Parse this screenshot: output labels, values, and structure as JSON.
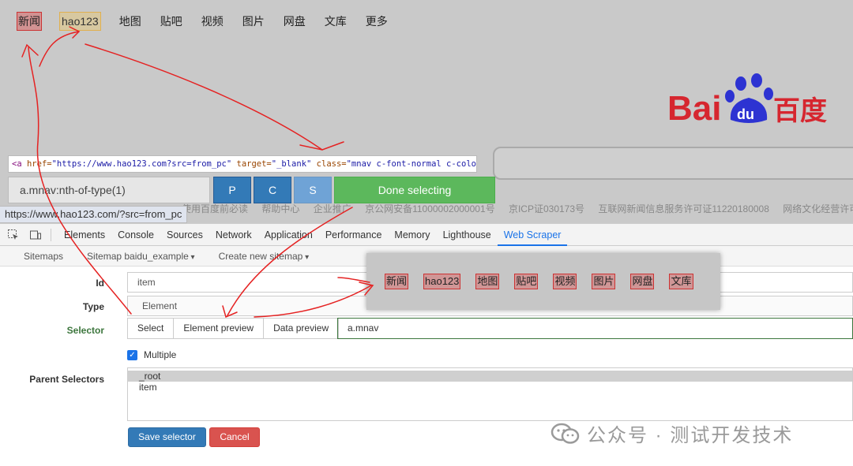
{
  "baidu": {
    "nav": [
      "新闻",
      "hao123",
      "地图",
      "贴吧",
      "视频",
      "图片",
      "网盘",
      "文库",
      "更多"
    ],
    "logo_text_left": "Bai",
    "logo_text_du": "du",
    "logo_text_cn": "百度",
    "footer": [
      "使用百度前必读",
      "帮助中心",
      "企业推广",
      "京公网安备11000002000001号",
      "京ICP证030173号",
      "互联网新闻信息服务许可证11220180008",
      "网络文化经营许可证："
    ]
  },
  "html_tip": {
    "open": "<a",
    "href_attr": "href=",
    "href_val": "\"https://www.hao123.com?src=from_pc\"",
    "target_attr": "target=",
    "target_val": "\"_blank\"",
    "class_attr": "class=",
    "class_val": "\"mnav c-font-normal c-color-t\"",
    "close": ">"
  },
  "selector_bar": {
    "value": "a.mnav:nth-of-type(1)",
    "p_label": "P",
    "c_label": "C",
    "s_label": "S",
    "done_label": "Done selecting"
  },
  "status_url": "https://www.hao123.com/?src=from_pc",
  "devtools": {
    "tabs": [
      "Elements",
      "Console",
      "Sources",
      "Network",
      "Application",
      "Performance",
      "Memory",
      "Lighthouse",
      "Web Scraper"
    ],
    "active_tab": "Web Scraper"
  },
  "ws_nav": {
    "sitemaps": "Sitemaps",
    "sitemap": "Sitemap baidu_example",
    "create": "Create new sitemap"
  },
  "form": {
    "id_label": "Id",
    "id_value": "item",
    "type_label": "Type",
    "type_value": "Element",
    "selector_label": "Selector",
    "select_btn": "Select",
    "element_preview_btn": "Element preview",
    "data_preview_btn": "Data preview",
    "selector_value": "a.mnav",
    "multiple_label": "Multiple",
    "multiple_checked": true,
    "parent_label": "Parent Selectors",
    "parents": [
      "_root",
      "item"
    ],
    "save_label": "Save selector",
    "cancel_label": "Cancel"
  },
  "preview_items": [
    "新闻",
    "hao123",
    "地图",
    "贴吧",
    "视频",
    "图片",
    "网盘",
    "文库"
  ],
  "watermark": "公众号 · 测试开发技术",
  "colors": {
    "primary": "#337ab7",
    "done_green": "#5cb85c",
    "cancel_red": "#d9534f",
    "baidu_red": "#d6262f",
    "baidu_blue": "#2d33d2",
    "annotation_red": "#e52222"
  }
}
